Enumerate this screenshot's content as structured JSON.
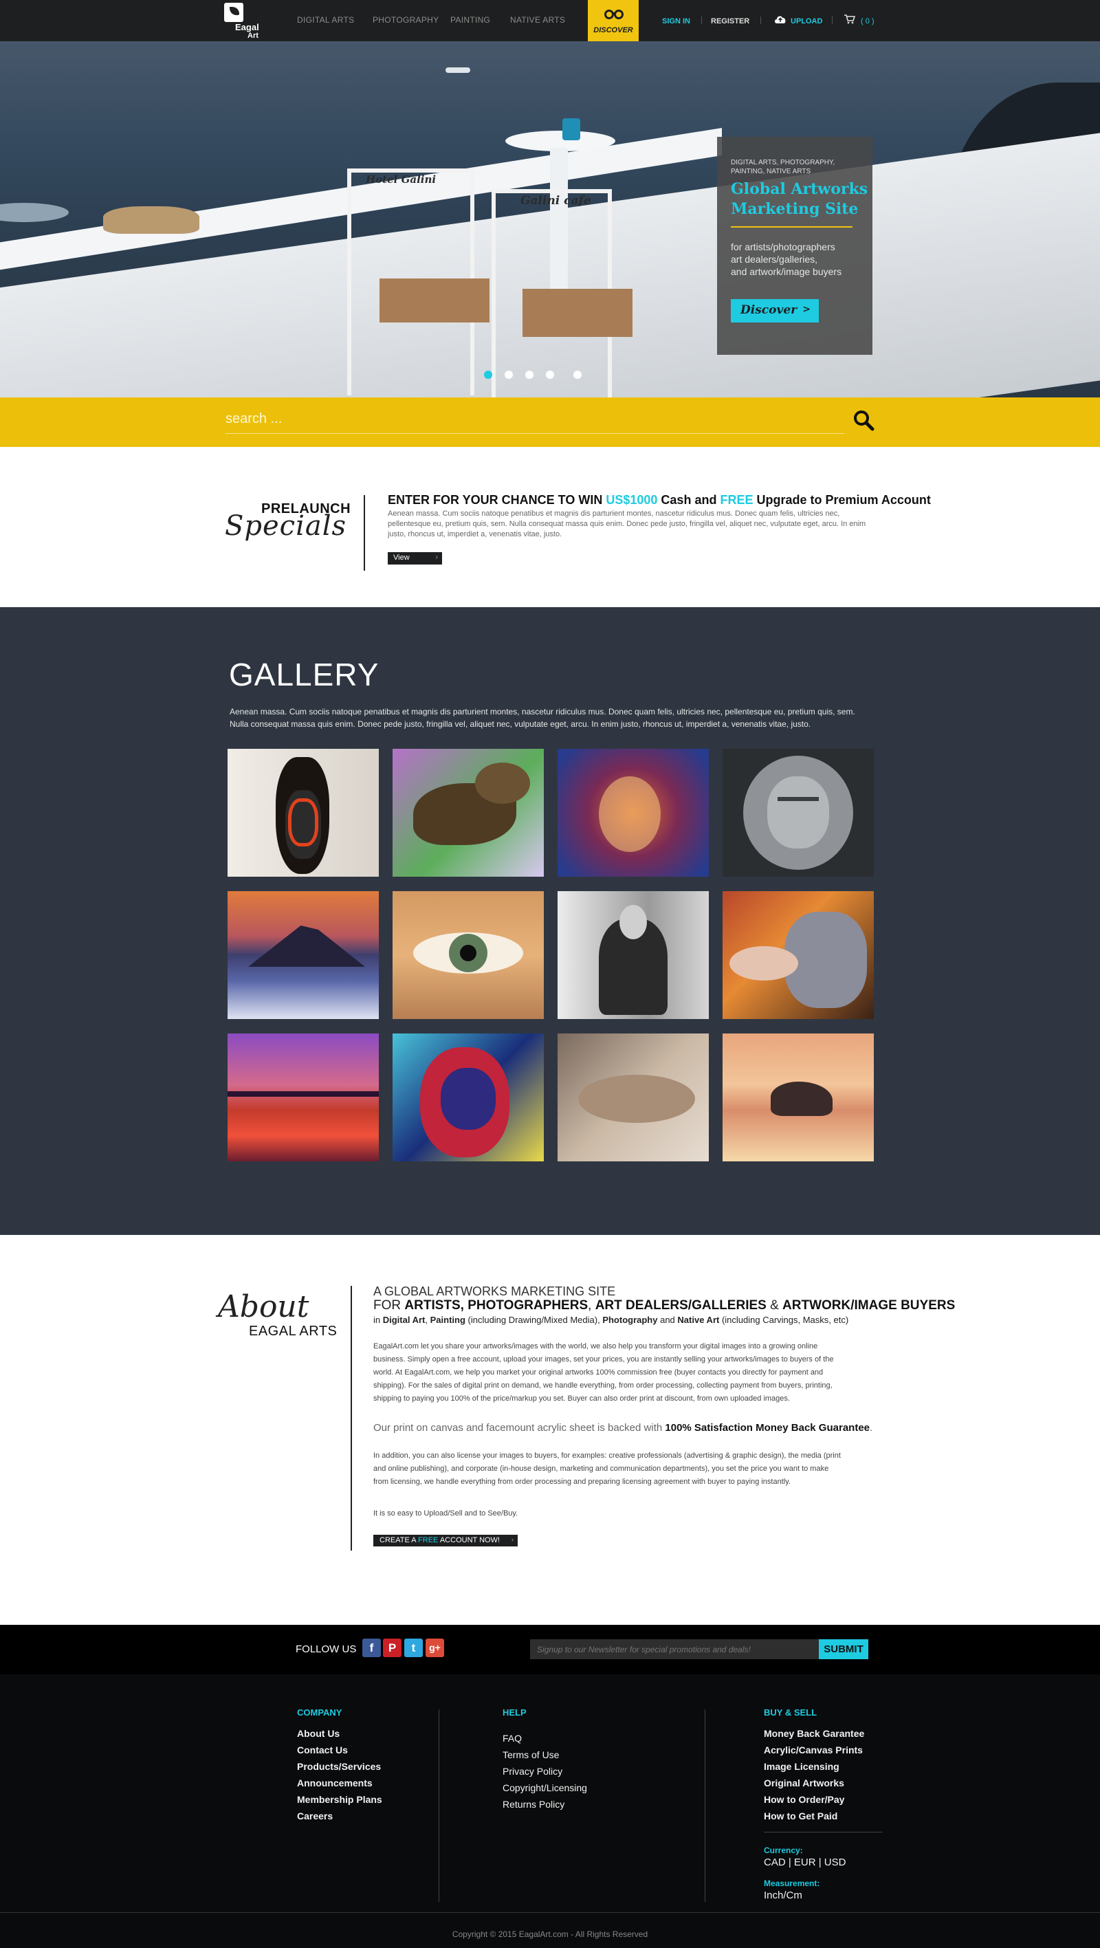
{
  "header": {
    "logo_text_1": "Eagal",
    "logo_text_2": "Art",
    "nav": [
      "DIGITAL ARTS",
      "PHOTOGRAPHY",
      "PAINTING",
      "NATIVE ARTS"
    ],
    "discover_label": "DISCOVER",
    "sign_in": "SIGN IN",
    "register": "REGISTER",
    "upload": "UPLOAD",
    "cart_count": "( 0 )",
    "accent_color": "#1ecbe1",
    "discover_color": "#f1c40f"
  },
  "hero": {
    "chair_sign_1": "Hotel Galini",
    "chair_sign_2": "Galini cafe",
    "box_small": "DIGITAL ARTS, PHOTOGRAPHY, PAINTING, NATIVE ARTS",
    "box_title": "Global Artworks Marketing Site",
    "box_desc_1": "for artists/photographers",
    "box_desc_2": "art dealers/galleries,",
    "box_desc_3": "and artwork/image buyers",
    "box_button": "Discover",
    "box_button_arrow": ">",
    "slides_total": 5,
    "active_slide": 1
  },
  "search": {
    "placeholder": "search ..."
  },
  "prelaunch": {
    "title_1": "PRELAUNCH",
    "title_2": "Specials",
    "headline_pre": "ENTER FOR YOUR CHANCE TO WIN ",
    "headline_amount": "US$1000",
    "headline_mid": " Cash and ",
    "headline_free": "FREE",
    "headline_post": " Upgrade to Premium Account",
    "body": "Aenean massa. Cum sociis natoque penatibus et magnis dis parturient montes, nascetur ridiculus mus. Donec quam felis, ultricies nec, pellentesque eu, pretium quis, sem. Nulla consequat massa quis enim. Donec pede justo, fringilla vel, aliquet nec, vulputate eget, arcu. In enim justo, rhoncus ut, imperdiet a, venenatis vitae, justo.",
    "button": "View",
    "button_arrow": "›"
  },
  "gallery": {
    "title": "GALLERY",
    "description": "Aenean massa. Cum sociis natoque penatibus et magnis dis parturient montes, nascetur ridiculus mus. Donec quam felis, ultricies nec, pellentesque eu, pretium quis, sem. Nulla consequat massa quis enim. Donec pede justo, fringilla vel, aliquet nec, vulputate eget, arcu. In enim justo, rhoncus ut, imperdiet a, venenatis vitae, justo.",
    "items": [
      {
        "name": "native-mask"
      },
      {
        "name": "moose-abstract"
      },
      {
        "name": "psychedelic-faces"
      },
      {
        "name": "stone-face-carving"
      },
      {
        "name": "mountain-above-clouds"
      },
      {
        "name": "eye-closeup"
      },
      {
        "name": "woman-on-chair"
      },
      {
        "name": "lion-woman-fantasy"
      },
      {
        "name": "purple-sunset-lake"
      },
      {
        "name": "colorful-figure-painting"
      },
      {
        "name": "reclining-figure"
      },
      {
        "name": "polar-bear-sunset"
      }
    ]
  },
  "about": {
    "script": "About",
    "sub": "EAGAL ARTS",
    "h1": "A GLOBAL ARTWORKS MARKETING SITE",
    "h2_pre": "FOR ",
    "h2_artists": "ARTISTS, PHOTOGRAPHERS",
    "h2_comma": ", ",
    "h2_dealers": "ART DEALERS/GALLERIES",
    "h2_amp": " & ",
    "h2_buyers": "ARTWORK/IMAGE BUYERS",
    "h3_pre": "in ",
    "h3_digital": "Digital Art",
    "h3_c1": ", ",
    "h3_painting": "Painting",
    "h3_mid": " (including Drawing/Mixed Media), ",
    "h3_photo": "Photography",
    "h3_and": " and ",
    "h3_native": "Native Art",
    "h3_post": " (including Carvings, Masks, etc)",
    "p1": "EagalArt.com let you share your artworks/images with the world, we also help you transform your digital images into a growing online business. Simply open a free account, upload your images, set your prices, you are instantly selling your artworks/images to buyers of the world. At EagalArt.com, we help you market your original artworks 100% commission free (buyer contacts you directly for payment and shipping). For the sales of digital print on demand, we handle everything, from order processing, collecting payment from buyers, printing, shipping to paying you 100% of the price/markup you set. Buyer can also order print at discount, from own uploaded images.",
    "guarantee_pre": "Our print on canvas and facemount acrylic sheet is backed with ",
    "guarantee_bold": "100% Satisfaction Money Back Guarantee",
    "guarantee_post": ".",
    "p2": "In addition, you can also license your images to buyers, for examples: creative professionals (advertising & graphic design), the media (print and online publishing), and corporate (in-house design, marketing and communication departments), you set the price you want to make from licensing, we handle everything from order processing and preparing licensing agreement with buyer to paying instantly.",
    "p3": "It is so easy to Upload/Sell and to See/Buy.",
    "cta_pre": "CREATE A ",
    "cta_free": "FREE",
    "cta_post": " ACCOUNT NOW!",
    "cta_arrow": "›"
  },
  "follow": {
    "label": "FOLLOW US",
    "socials": [
      {
        "name": "facebook",
        "glyph": "f",
        "color": "#3b5998"
      },
      {
        "name": "pinterest",
        "glyph": "P",
        "color": "#cb2027"
      },
      {
        "name": "twitter",
        "glyph": "t",
        "color": "#2fa7e0"
      },
      {
        "name": "google-plus",
        "glyph": "g+",
        "color": "#dd4b39"
      }
    ],
    "newsletter_placeholder": "Signup to our Newsletter for special promotions and deals!",
    "submit": "SUBMIT"
  },
  "footer": {
    "company": {
      "heading": "COMPANY",
      "links": [
        "About Us",
        "Contact Us",
        "Products/Services",
        "Announcements",
        "Membership Plans",
        "Careers"
      ]
    },
    "help": {
      "heading": "HELP",
      "links": [
        "FAQ",
        "Terms of Use",
        "Privacy Policy",
        "Copyright/Licensing",
        "Returns Policy"
      ]
    },
    "buy_sell": {
      "heading": "BUY & SELL",
      "links": [
        "Money Back Garantee",
        "Acrylic/Canvas Prints",
        "Image Licensing",
        "Original Artworks",
        "How to Order/Pay",
        "How to Get Paid"
      ]
    },
    "currency_label": "Currency:",
    "currency_value": "CAD | EUR | USD",
    "measurement_label": "Measurement:",
    "measurement_value": "Inch/Cm",
    "copyright": "Copyright © 2015 EagalArt.com - All Rights Reserved"
  }
}
